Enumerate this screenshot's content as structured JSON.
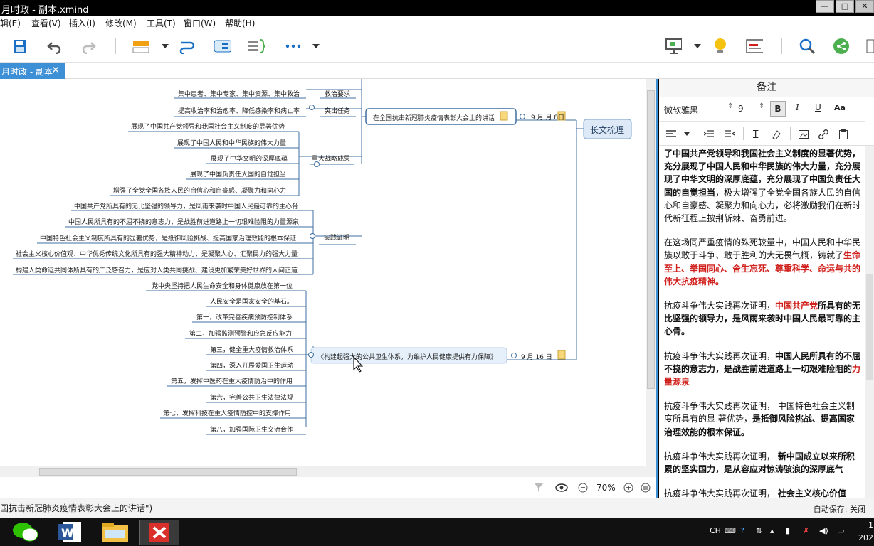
{
  "window": {
    "title": "月时政 - 副本.xmind",
    "buttons": [
      "—",
      "□",
      "✕"
    ]
  },
  "menu": [
    "辑(E)",
    "查看(V)",
    "插入(I)",
    "修改(M)",
    "工具(T)",
    "窗口(W)",
    "帮助(H)"
  ],
  "toolbar": {
    "icons": [
      "save-icon",
      "undo-icon",
      "redo-icon",
      "topic-icon",
      "relationship-icon",
      "boundary-icon",
      "summary-icon",
      "more-icon",
      "presentation-icon",
      "idea-icon",
      "notes-icon",
      "search-icon",
      "share-icon"
    ]
  },
  "tab": {
    "label": "月时政 - 副本",
    "close": "✕"
  },
  "map": {
    "root": "长文梳理",
    "branches": [
      {
        "title": "在全国抗击新冠肺炎疫情表彰大会上的讲话",
        "date": "9 月 月 8日",
        "groups": [
          {
            "label": "救治要求",
            "items": [
              "集中患者、集中专家、集中资源、集中救治"
            ]
          },
          {
            "label": "突出任务",
            "items": [
              "提高收治率和治愈率、降低感染率和病亡率"
            ]
          },
          {
            "label": "重大战略成果",
            "items": [
              "展现了中国共产党领导和我国社会主义制度的显著优势",
              "展现了中国人民和中华民族的伟大力量",
              "展现了中华文明的深厚底蕴",
              "展现了中国负责任大国的自觉担当",
              "增强了全党全国各族人民的自信心和自豪感、凝聚力和向心力"
            ]
          },
          {
            "label": "实践证明",
            "items": [
              "中国共产党所具有的无比坚强的领导力，是风雨来袭时中国人民最可靠的主心骨",
              "中国人民所具有的不屈不挠的意志力，是战胜前进道路上一切艰难险阻的力量源泉",
              "中国特色社会主义制度所具有的显著优势，是抵御风险挑战、提高国家治理效能的根本保证",
              "社会主义核心价值观、中华优秀传统文化所具有的强大精神动力，是凝聚人心、汇聚民力的强大力量",
              "构建人类命运共同体所具有的广泛感召力，是应对人类共同挑战、建设更加繁荣美好世界的人间正道"
            ]
          }
        ]
      },
      {
        "title": "《构建起强大的公共卫生体系，为维护人民健康提供有力保障》",
        "date": "9 月 16 日",
        "items": [
          "党中央坚持把人民生命安全和身体健康放在第一位",
          "人民安全是国家安全的基石。",
          "第一，改革完善疾病预防控制体系",
          "第二，加强监测预警和应急反应能力",
          "第三，健全重大疫情救治体系",
          "第四，深入开展爱国卫生运动",
          "第五，发挥中医药在重大疫情防治中的作用",
          "第六，完善公共卫生法律法规",
          "第七，发挥科技在重大疫情防控中的支撑作用",
          "第八，加强国际卫生交流合作"
        ]
      }
    ]
  },
  "zoom": "70%",
  "notes": {
    "header": "备注",
    "font": "微软雅黑",
    "size": "9",
    "paragraphs": [
      [
        {
          "t": "了中国共产党领导和我国社会主义制度的显著优势，充分展现了中国人民和中华民族的伟大力量，充分展现了中华文明的深厚底蕴，充分展现了中国负责任大国的自觉担当",
          "s": "b"
        },
        {
          "t": "，极大增强了全党全国各族人民的自信心和自豪感、凝聚力和向心力，必将激励我们在新时代新征程上披荆斩棘、奋勇前进。",
          "s": ""
        }
      ],
      [
        {
          "t": "在这场同严重疫情的殊死较量中，中国人民和中华民族以敢于斗争、敢于胜利的大无畏气概，铸就了",
          "s": ""
        },
        {
          "t": "生命至上、举国同心、舍生忘死、尊重科学、命运与共的伟大抗疫精神。",
          "s": "red"
        }
      ],
      [
        {
          "t": "抗疫斗争伟大实践再次证明，",
          "s": ""
        },
        {
          "t": "中国共产党",
          "s": "red"
        },
        {
          "t": "所具有的无比坚强的领导力，是风雨来袭时中国人民最可靠的主心骨。",
          "s": "b"
        }
      ],
      [
        {
          "t": "抗疫斗争伟大实践再次证明，",
          "s": ""
        },
        {
          "t": "中国人民所具有的不屈不挠的意志力，是战胜前进道路上一切艰难险阻的",
          "s": "b"
        },
        {
          "t": "力量源泉",
          "s": "red"
        }
      ],
      [
        {
          "t": "抗疫斗争伟大实践再次证明， 中国特色社会主义制度所具有的显 著优势，",
          "s": ""
        },
        {
          "t": "是抵御风险挑战、提高国家治理效能的根本保证。",
          "s": "b"
        }
      ],
      [
        {
          "t": "抗疫斗争伟大实践再次证明， ",
          "s": ""
        },
        {
          "t": "新中国成立以来所积累的坚实国力，是从容应对惊涛骇浪的深厚底气",
          "s": "b"
        }
      ],
      [
        {
          "t": "抗疫斗争伟大实践再次证明， ",
          "s": ""
        },
        {
          "t": "社会主义核心价值观、中华优秀传统文化所具有的强大精神动力，是凝",
          "s": "b"
        }
      ]
    ]
  },
  "status": {
    "left": "国抗击新冠肺炎疫情表彰大会上的讲话\")",
    "right": "自动保存: 关闭"
  },
  "taskbar": {
    "apps": [
      "wechat-icon",
      "word-icon",
      "explorer-icon",
      "xmind-icon"
    ],
    "tray": [
      "CH",
      "1",
      "202"
    ]
  },
  "colors": {
    "accent": "#3d8fd6",
    "line": "#3f6fa0",
    "red": "#d0201c"
  }
}
